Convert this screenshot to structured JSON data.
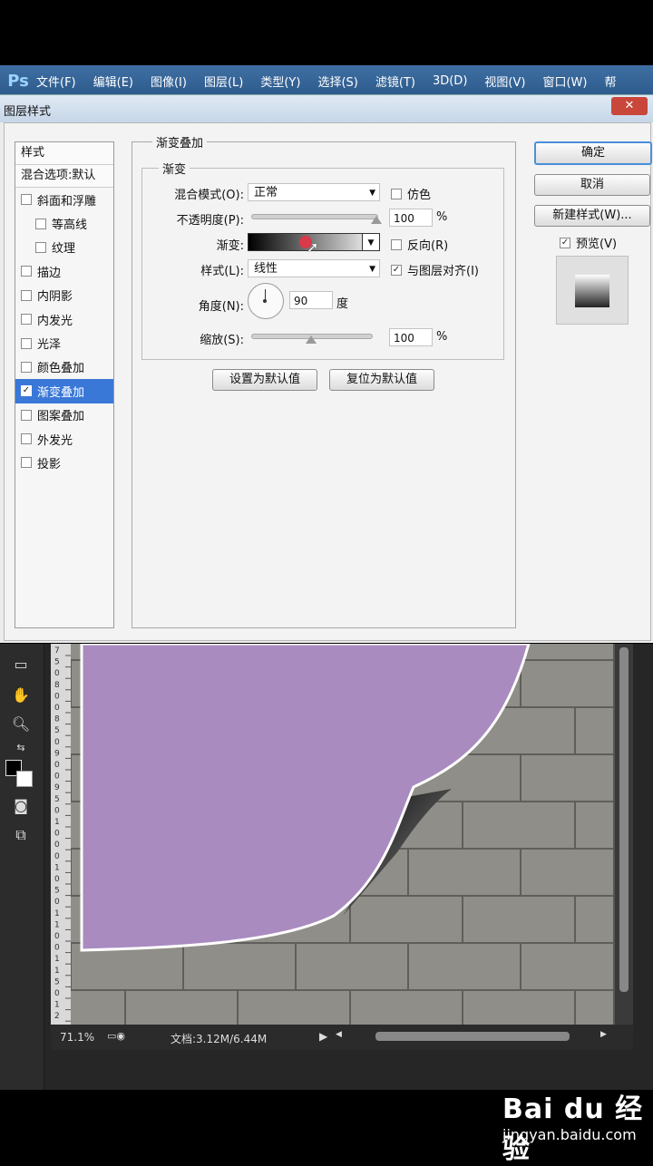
{
  "app": {
    "logo": "Ps",
    "menu": [
      "文件(F)",
      "编辑(E)",
      "图像(I)",
      "图层(L)",
      "类型(Y)",
      "选择(S)",
      "滤镜(T)",
      "3D(D)",
      "视图(V)",
      "窗口(W)",
      "帮"
    ]
  },
  "dialog": {
    "title": "图层样式",
    "styles_header": "样式",
    "blend_default": "混合选项:默认",
    "styles": [
      {
        "label": "斜面和浮雕",
        "checked": false,
        "sub": false,
        "active": false
      },
      {
        "label": "等高线",
        "checked": false,
        "sub": true,
        "active": false
      },
      {
        "label": "纹理",
        "checked": false,
        "sub": true,
        "active": false
      },
      {
        "label": "描边",
        "checked": false,
        "sub": false,
        "active": false
      },
      {
        "label": "内阴影",
        "checked": false,
        "sub": false,
        "active": false
      },
      {
        "label": "内发光",
        "checked": false,
        "sub": false,
        "active": false
      },
      {
        "label": "光泽",
        "checked": false,
        "sub": false,
        "active": false
      },
      {
        "label": "颜色叠加",
        "checked": false,
        "sub": false,
        "active": false
      },
      {
        "label": "渐变叠加",
        "checked": true,
        "sub": false,
        "active": true
      },
      {
        "label": "图案叠加",
        "checked": false,
        "sub": false,
        "active": false
      },
      {
        "label": "外发光",
        "checked": false,
        "sub": false,
        "active": false
      },
      {
        "label": "投影",
        "checked": false,
        "sub": false,
        "active": false
      }
    ],
    "section_title": "渐变叠加",
    "subsection_title": "渐变",
    "blend_mode_label": "混合模式(O):",
    "blend_mode_value": "正常",
    "dither_label": "仿色",
    "opacity_label": "不透明度(P):",
    "opacity_value": "100",
    "opacity_fraction": 1.0,
    "percent": "%",
    "gradient_label": "渐变:",
    "reverse_label": "反向(R)",
    "style_label": "样式(L):",
    "style_value": "线性",
    "align_label": "与图层对齐(I)",
    "angle_label": "角度(N):",
    "angle_value": "90",
    "degree": "度",
    "scale_label": "缩放(S):",
    "scale_value": "100",
    "scale_fraction": 0.5,
    "set_default": "设置为默认值",
    "reset_default": "复位为默认值",
    "ok": "确定",
    "cancel": "取消",
    "new_style": "新建样式(W)...",
    "preview_label": "预览(V)",
    "close": "✕"
  },
  "status": {
    "zoom": "71.1%",
    "doc": "文档:3.12M/6.44M"
  },
  "ruler_ticks": [
    "7",
    "5",
    "0",
    "8",
    "0",
    "0",
    "8",
    "5",
    "0",
    "9",
    "0",
    "0",
    "9",
    "5",
    "0",
    "1",
    "0",
    "0",
    "0",
    "1",
    "0",
    "5",
    "0",
    "1",
    "1",
    "0",
    "0",
    "1",
    "1",
    "5",
    "0",
    "1",
    "2"
  ],
  "watermark": {
    "logo": "Bai du 经验",
    "url": "jingyan.baidu.com"
  },
  "colors": {
    "shape": "#a98bc0",
    "active_row": "#3a78d8",
    "menubar": "#2d5a8c"
  }
}
